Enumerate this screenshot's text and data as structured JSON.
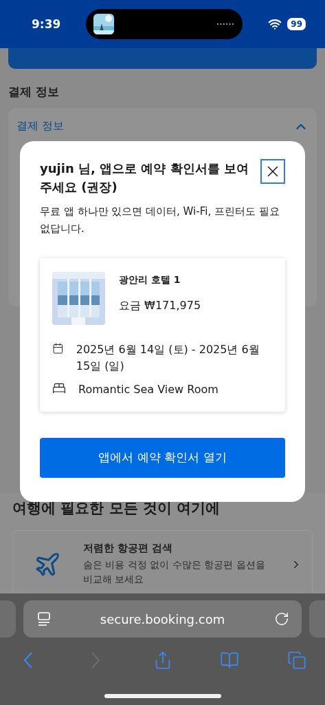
{
  "status_bar": {
    "time": "9:39",
    "battery": "99"
  },
  "page": {
    "section_title": "결제 정보",
    "accordion": {
      "label": "결제 정보",
      "expanded": true
    },
    "feature_heading": "여행에 필요한 모든 것이 여기에",
    "feature_card": {
      "title": "저렴한 항공편 검색",
      "description": "숨은 비용 걱정 없이 수많은 항공편 옵션을 비교해 보세요"
    }
  },
  "dialog": {
    "title": "yujin 님, 앱으로 예약 확인서를 보여주세요 (권장)",
    "description": "무료 앱 하나만 있으면 데이터, Wi-Fi, 프린터도 필요 없답니다.",
    "booking": {
      "hotel": "광안리 호텔 1",
      "price": "요금 ₩171,975",
      "details": [
        {
          "kind": "dates",
          "text": "2025년 6월 14일 (토) - 2025년 6월 15일 (일)"
        },
        {
          "kind": "room",
          "text": "Romantic Sea View Room"
        }
      ]
    },
    "button": "앱에서 예약 확인서 열기"
  },
  "browser": {
    "url": "secure.booking.com",
    "toolbar": [
      {
        "kind": "back",
        "disabled": false
      },
      {
        "kind": "forward",
        "disabled": true
      },
      {
        "kind": "share",
        "disabled": false
      },
      {
        "kind": "bookmarks",
        "disabled": false
      },
      {
        "kind": "tabs",
        "disabled": false
      }
    ]
  }
}
